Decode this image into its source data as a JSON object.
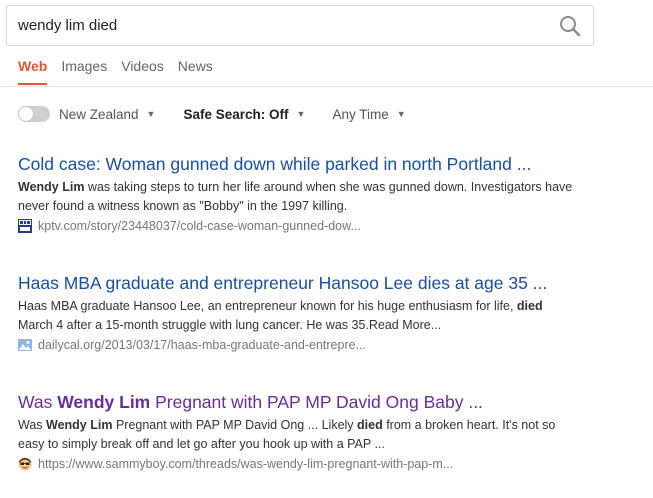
{
  "search": {
    "query": "wendy lim died",
    "icon": "search-icon"
  },
  "tabs": [
    {
      "label": "Web",
      "active": true
    },
    {
      "label": "Images",
      "active": false
    },
    {
      "label": "Videos",
      "active": false
    },
    {
      "label": "News",
      "active": false
    }
  ],
  "filters": {
    "region": "New Zealand",
    "safe_search": "Safe Search: Off",
    "time": "Any Time"
  },
  "colors": {
    "accent": "#de5833",
    "link": "#1a4fa0",
    "visited": "#6a2c9b"
  },
  "results": [
    {
      "title": "Cold case: Woman gunned down while parked in north Portland ...",
      "snippet": [
        {
          "text": "Wendy Lim",
          "bold": true
        },
        {
          "text": " was taking steps to turn her life around when she was gunned down. Investigators have never found a witness known as \"Bobby\" in the 1997 killing.",
          "bold": false
        }
      ],
      "url": "kptv.com/story/23448037/cold-case-woman-gunned-dow...",
      "favicon": "fox12-icon"
    },
    {
      "title": "Haas MBA graduate and entrepreneur Hansoo Lee dies at age 35 ...",
      "snippet": [
        {
          "text": "Haas MBA graduate Hansoo Lee, an entrepreneur known for his huge enthusiasm for life, ",
          "bold": false
        },
        {
          "text": "died",
          "bold": true
        },
        {
          "text": " March 4 after a 15-month struggle with lung cancer. He was 35.Read More...",
          "bold": false
        }
      ],
      "url": "dailycal.org/2013/03/17/haas-mba-graduate-and-entrepre...",
      "favicon": "image-placeholder-icon"
    },
    {
      "title_parts": [
        {
          "text": "Was ",
          "bold": false
        },
        {
          "text": "Wendy Lim",
          "bold": true
        },
        {
          "text": " Pregnant with PAP MP David Ong Baby ...",
          "bold": false
        }
      ],
      "snippet": [
        {
          "text": "Was ",
          "bold": false
        },
        {
          "text": "Wendy Lim",
          "bold": true
        },
        {
          "text": " Pregnant with PAP MP David Ong ... Likely ",
          "bold": false
        },
        {
          "text": "died",
          "bold": true
        },
        {
          "text": " from a broken heart. It's not so easy to simply break off and let go after you hook up with a PAP ...",
          "bold": false
        }
      ],
      "url": "https://www.sammyboy.com/threads/was-wendy-lim-pregnant-with-pap-m...",
      "favicon": "avatar-face-icon"
    }
  ]
}
